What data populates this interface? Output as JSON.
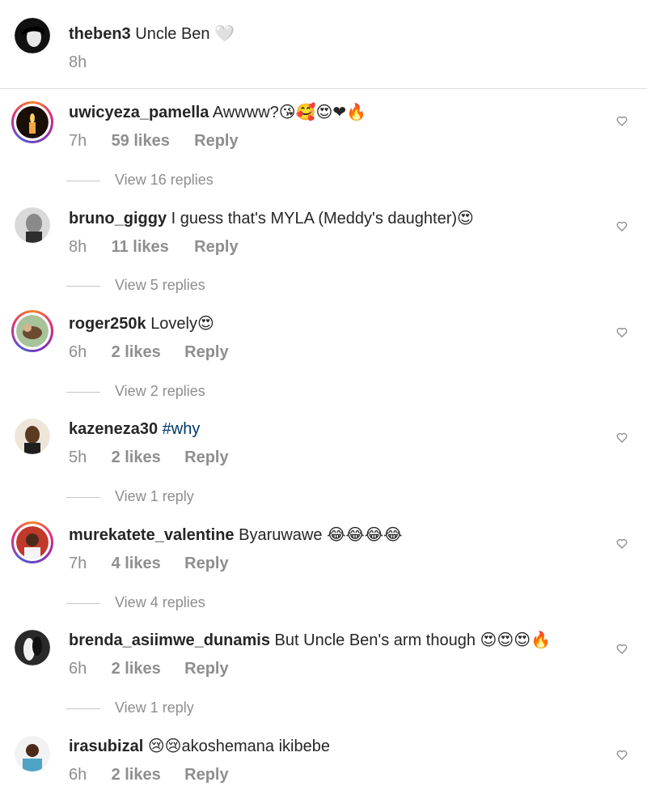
{
  "caption": {
    "username": "theben3",
    "text": "Uncle Ben",
    "emoji": "🤍",
    "time": "8h"
  },
  "comments": [
    {
      "username": "uwicyeza_pamella",
      "text": "Awwww",
      "emoji": "?😘🥰😍❤🔥",
      "time": "7h",
      "likes": "59 likes",
      "reply": "Reply",
      "view_replies": "View 16 replies",
      "avatar_color": "#2b1a0e"
    },
    {
      "username": "bruno_giggy",
      "text": "I guess that's MYLA (Meddy's daughter)",
      "emoji": "😍",
      "time": "8h",
      "likes": "11 likes",
      "reply": "Reply",
      "view_replies": "View 5 replies",
      "avatar_color": "#9e9e9e"
    },
    {
      "username": "roger250k",
      "text": "Lovely",
      "emoji": "😍",
      "time": "6h",
      "likes": "2 likes",
      "reply": "Reply",
      "view_replies": "View 2 replies",
      "avatar_color": "#6b8f6a"
    },
    {
      "username": "kazeneza30",
      "text": "#why",
      "emoji": "",
      "time": "5h",
      "likes": "2 likes",
      "reply": "Reply",
      "view_replies": "View 1 reply",
      "avatar_color": "#5a3b22"
    },
    {
      "username": "murekatete_valentine",
      "text": "Byaruwawe",
      "emoji": "😂😂😂😂",
      "time": "7h",
      "likes": "4 likes",
      "reply": "Reply",
      "view_replies": "View 4 replies",
      "avatar_color": "#c0392b"
    },
    {
      "username": "brenda_asiimwe_dunamis",
      "text": "But Uncle Ben's arm though",
      "emoji": "😍😍😍🔥",
      "time": "6h",
      "likes": "2 likes",
      "reply": "Reply",
      "view_replies": "View 1 reply",
      "avatar_color": "#3d3d3d"
    },
    {
      "username": "irasubizal",
      "text": "akoshemana ikibebe",
      "emoji_before": "😢😢",
      "time": "6h",
      "likes": "2 likes",
      "reply": "Reply",
      "avatar_color": "#4fa3c7"
    }
  ],
  "colors": {
    "text": "#262626",
    "secondary": "#8e8e8e",
    "hashtag": "#00376b",
    "divider": "#dbdbdb"
  }
}
